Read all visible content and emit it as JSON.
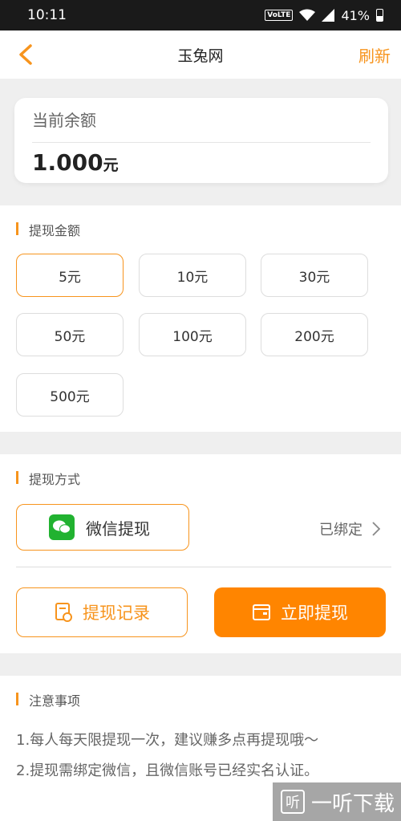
{
  "status_bar": {
    "time": "10:11",
    "network": "VoLTE",
    "battery": "41%"
  },
  "navbar": {
    "title": "玉兔网",
    "refresh_label": "刷新"
  },
  "balance": {
    "label": "当前余额",
    "value": "1.000",
    "unit": "元"
  },
  "amount_section": {
    "title": "提现金额",
    "options": [
      "5元",
      "10元",
      "30元",
      "50元",
      "100元",
      "200元",
      "500元"
    ],
    "selected": "5元"
  },
  "method_section": {
    "title": "提现方式",
    "wechat_label": "微信提现",
    "bound_status": "已绑定",
    "records_label": "提现记录",
    "withdraw_label": "立即提现"
  },
  "notes_section": {
    "title": "注意事项",
    "lines": [
      "1.每人每天限提现一次，建议赚多点再提现哦～",
      "2.提现需绑定微信，且微信账号已经实名认证。"
    ]
  },
  "watermark": {
    "text": "一听下载",
    "icon_char": "听"
  },
  "colors": {
    "accent": "#f7941d",
    "primary_button": "#ff8500",
    "wechat_green": "#21b230"
  }
}
